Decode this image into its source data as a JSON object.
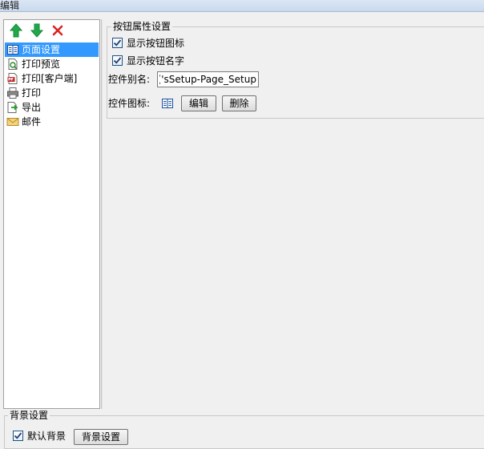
{
  "window": {
    "title": "编辑"
  },
  "toolbar": {
    "move_up": {
      "icon": "arrow-up-icon",
      "color": "#22a84a"
    },
    "move_down": {
      "icon": "arrow-down-icon",
      "color": "#22a84a"
    },
    "delete": {
      "icon": "close-icon",
      "color": "#e02020"
    }
  },
  "tree": {
    "items": [
      {
        "label": "页面设置",
        "icon": "page-setup-icon",
        "selected": true
      },
      {
        "label": "打印预览",
        "icon": "print-preview-icon"
      },
      {
        "label": "打印[客户端]",
        "icon": "pdf-file-icon"
      },
      {
        "label": "打印",
        "icon": "printer-icon"
      },
      {
        "label": "导出",
        "icon": "export-icon"
      },
      {
        "label": "邮件",
        "icon": "mail-icon"
      }
    ]
  },
  "button_props": {
    "legend": "按钮属性设置",
    "show_icon": {
      "label": "显示按钮图标",
      "checked": true
    },
    "show_name": {
      "label": "显示按钮名字",
      "checked": true
    },
    "alias_label": "控件别名:",
    "alias_value": "sSetup-Page_Setup')}",
    "icon_label": "控件图标:",
    "icon_preview": "page-setup-icon",
    "edit_button": "编辑",
    "delete_button": "删除"
  },
  "background": {
    "legend": "背景设置",
    "checkbox_label": "默认背景",
    "checked": true,
    "button": "背景设置"
  },
  "colors": {
    "selection": "#3399ff",
    "border": "#a0a0a0",
    "window_bg": "#f0f0f0"
  }
}
